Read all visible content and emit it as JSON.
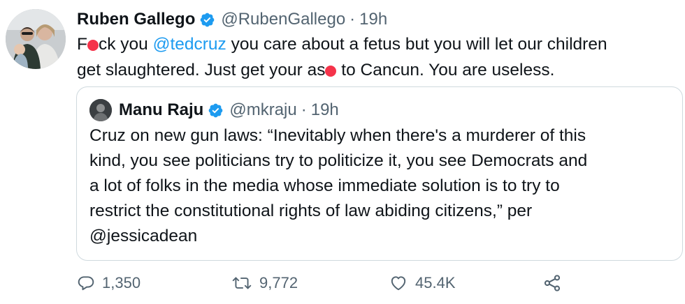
{
  "tweet": {
    "author_name": "Ruben Gallego",
    "author_handle": "@RubenGallego",
    "separator": "·",
    "timestamp": "19h",
    "text": {
      "line1_a": "F",
      "line1_b": "ck you ",
      "mention": "@tedcruz",
      "line1_c": " you care about a fetus but you will let our children",
      "line2_a": "get slaughtered.  Just get your as",
      "line2_b": " to Cancun. You are useless."
    }
  },
  "quoted_tweet": {
    "author_name": "Manu Raju",
    "author_handle": "@mkraju",
    "separator": "·",
    "timestamp": "19h",
    "lines": [
      "Cruz on new gun laws: “Inevitably when there's a murderer of this",
      "kind, you see politicians try to politicize it, you see Democrats and",
      "a lot of folks in the media whose immediate solution is to try to",
      "restrict the constitutional rights of law abiding citizens,” per",
      "@jessicadean"
    ]
  },
  "actions": {
    "reply_count": "1,350",
    "retweet_count": "9,772",
    "like_count": "45.4K"
  },
  "icons": {
    "reply": "comment-icon",
    "retweet": "retweet-icon",
    "like": "heart-icon",
    "share": "share-icon",
    "verified": "verified-badge-icon"
  },
  "colors": {
    "verified": "#1d9bf0",
    "mention": "#1d9bf0",
    "muted": "#536471",
    "censor_mark": "#f5334a"
  }
}
